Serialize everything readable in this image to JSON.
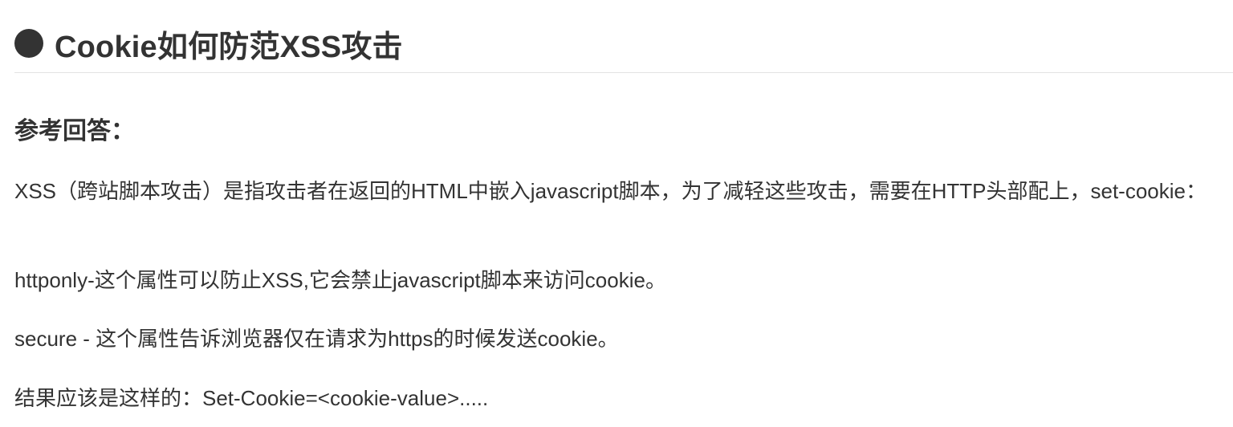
{
  "header": {
    "bullet_icon": "filled-circle-icon",
    "title": "Cookie如何防范XSS攻击"
  },
  "answer": {
    "heading": "参考回答：",
    "paragraphs": [
      "XSS（跨站脚本攻击）是指攻击者在返回的HTML中嵌入javascript脚本，为了减轻这些攻击，需要在HTTP头部配上，set-cookie：",
      "httponly-这个属性可以防止XSS,它会禁止javascript脚本来访问cookie。",
      "secure - 这个属性告诉浏览器仅在请求为https的时候发送cookie。",
      "结果应该是这样的：Set-Cookie=<cookie-value>....."
    ]
  }
}
